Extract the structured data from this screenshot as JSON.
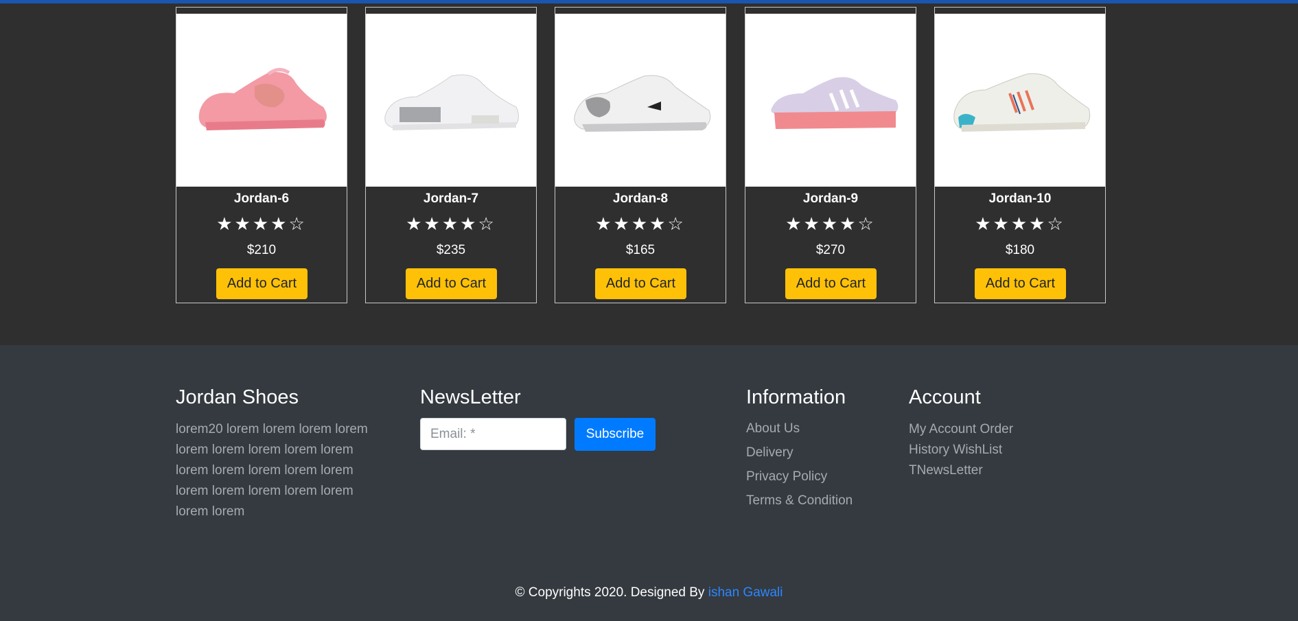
{
  "products": [
    {
      "name": "Jordan-6",
      "price": "$210",
      "rating": 4,
      "max_rating": 5,
      "button": "Add to Cart",
      "shoe_color": "pink"
    },
    {
      "name": "Jordan-7",
      "price": "$235",
      "rating": 4,
      "max_rating": 5,
      "button": "Add to Cart",
      "shoe_color": "white"
    },
    {
      "name": "Jordan-8",
      "price": "$165",
      "rating": 4,
      "max_rating": 5,
      "button": "Add to Cart",
      "shoe_color": "white-grey"
    },
    {
      "name": "Jordan-9",
      "price": "$270",
      "rating": 4,
      "max_rating": 5,
      "button": "Add to Cart",
      "shoe_color": "lilac-pink"
    },
    {
      "name": "Jordan-10",
      "price": "$180",
      "rating": 4,
      "max_rating": 5,
      "button": "Add to Cart",
      "shoe_color": "white-multicolor"
    }
  ],
  "footer": {
    "brand": {
      "title": "Jordan Shoes",
      "text_lines": [
        "lorem20 lorem lorem lorem lorem",
        "lorem lorem lorem lorem lorem",
        "lorem lorem lorem lorem lorem",
        "lorem lorem lorem lorem lorem",
        "lorem lorem"
      ]
    },
    "newsletter": {
      "title": "NewsLetter",
      "email_placeholder": "Email: *",
      "subscribe_label": "Subscribe"
    },
    "information": {
      "title": "Information",
      "links": [
        "About Us",
        "Delivery",
        "Privacy Policy",
        "Terms & Condition"
      ]
    },
    "account": {
      "title": "Account",
      "text_lines": [
        "My Account Order",
        "History WishList",
        "TNewsLetter"
      ]
    },
    "copyright": {
      "text": "© Copyrights 2020. Designed By ",
      "author": "ishan Gawali"
    }
  },
  "colors": {
    "accent_button": "#ffc107",
    "subscribe_button": "#007bff",
    "footer_bg": "#343a40",
    "products_bg": "#2f2f2f",
    "link_blue": "#2e86ff"
  }
}
